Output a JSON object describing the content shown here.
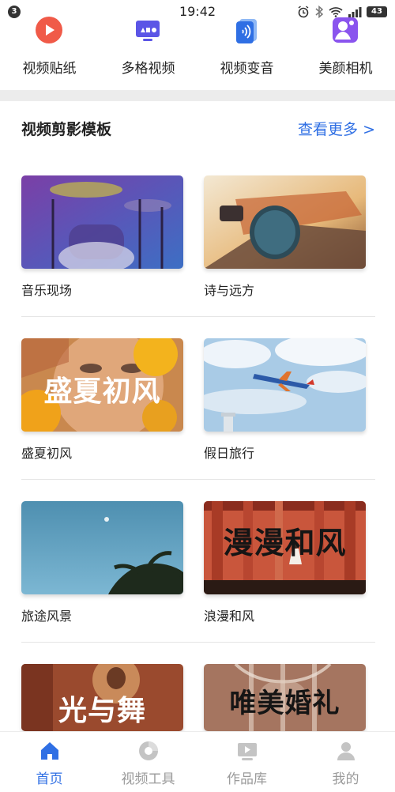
{
  "status_bar": {
    "notification_count": "3",
    "time": "19:42",
    "battery": "43",
    "icons": [
      "alarm-icon",
      "bluetooth-icon",
      "wifi-icon",
      "signal-icon",
      "battery-icon"
    ]
  },
  "features": [
    {
      "label": "视频贴纸",
      "icon": "video-sticker-icon"
    },
    {
      "label": "多格视频",
      "icon": "multi-grid-video-icon"
    },
    {
      "label": "视频变音",
      "icon": "voice-change-icon"
    },
    {
      "label": "美颜相机",
      "icon": "beauty-camera-icon"
    }
  ],
  "section": {
    "title": "视频剪影模板",
    "more_label": "查看更多 >"
  },
  "templates": [
    {
      "title": "音乐现场"
    },
    {
      "title": "诗与远方"
    },
    {
      "title": "盛夏初风",
      "overlay": "盛夏初风"
    },
    {
      "title": "假日旅行"
    },
    {
      "title": "旅途风景"
    },
    {
      "title": "浪漫和风",
      "overlay": "漫漫和风"
    },
    {
      "title": "",
      "overlay": "光与舞"
    },
    {
      "title": "",
      "overlay": "唯美婚礼"
    }
  ],
  "bottom_nav": [
    {
      "label": "首页",
      "icon": "home-icon",
      "active": true
    },
    {
      "label": "视频工具",
      "icon": "video-tool-icon",
      "active": false
    },
    {
      "label": "作品库",
      "icon": "works-library-icon",
      "active": false
    },
    {
      "label": "我的",
      "icon": "profile-icon",
      "active": false
    }
  ],
  "colors": {
    "accent": "#2f6fe4",
    "inactive": "#9a9a9a",
    "band": "#ececec"
  }
}
